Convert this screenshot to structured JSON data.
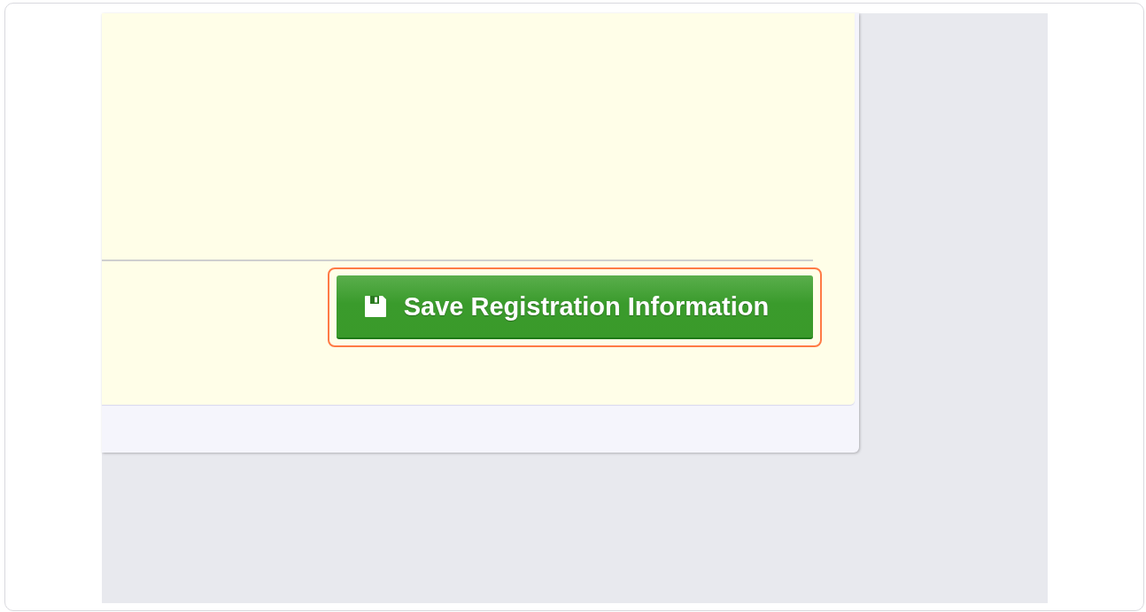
{
  "button": {
    "label": "Save Registration Information",
    "highlighted": true
  }
}
